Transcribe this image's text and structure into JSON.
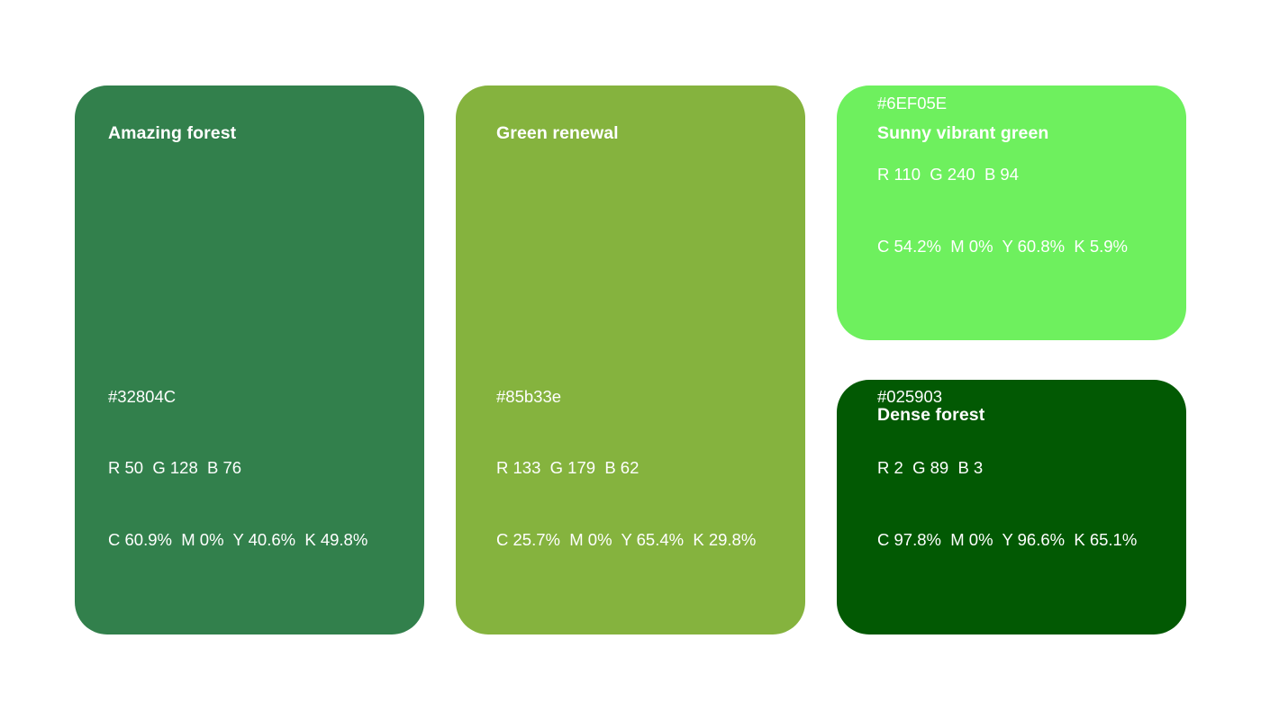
{
  "swatches": [
    {
      "name": "Amazing forest",
      "color": "#32804C",
      "hex": "#32804C",
      "rgb": "R 50  G 128  B 76",
      "cmyk": "C 60.9%  M 0%  Y 40.6%  K 49.8%"
    },
    {
      "name": "Green renewal",
      "color": "#85B33E",
      "hex": "#85b33e",
      "rgb": "R 133  G 179  B 62",
      "cmyk": "C 25.7%  M 0%  Y 65.4%  K 29.8%"
    },
    {
      "name": "Sunny vibrant green",
      "color": "#6EF05E",
      "hex": "#6EF05E",
      "rgb": "R 110  G 240  B 94",
      "cmyk": "C 54.2%  M 0%  Y 60.8%  K 5.9%"
    },
    {
      "name": "Dense forest",
      "color": "#025903",
      "hex": "#025903",
      "rgb": "R 2  G 89  B 3",
      "cmyk": "C 97.8%  M 0%  Y 96.6%  K 65.1%"
    }
  ]
}
